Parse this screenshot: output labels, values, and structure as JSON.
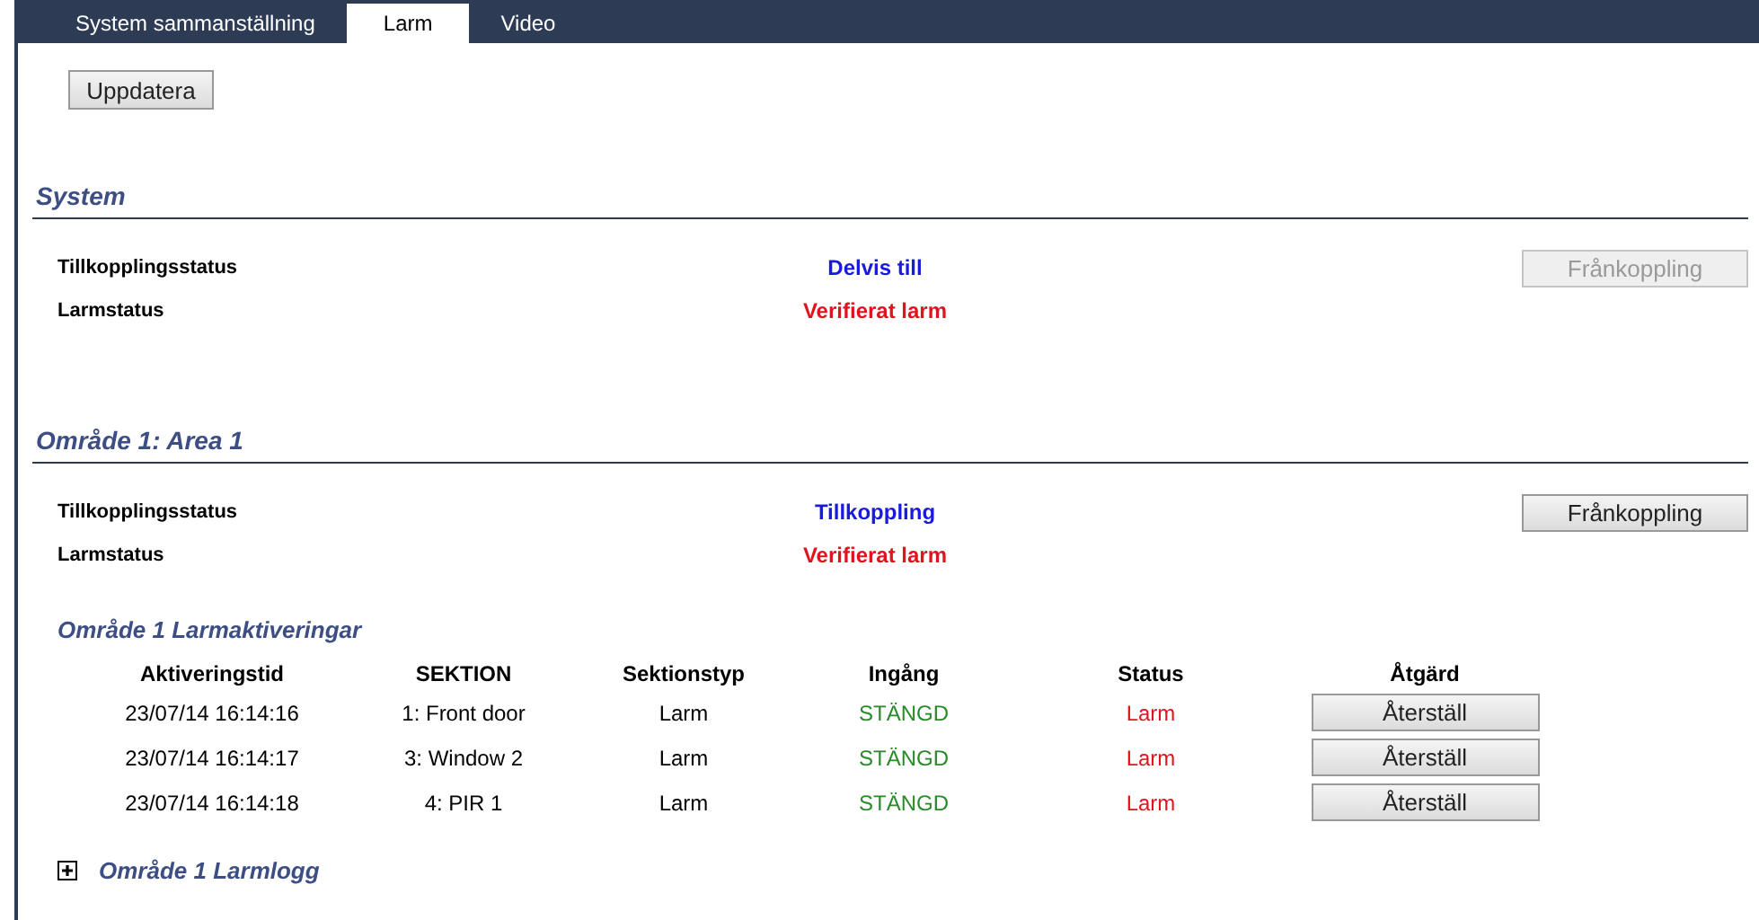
{
  "tabs": [
    {
      "label": "System sammanställning",
      "selected": false
    },
    {
      "label": "Larm",
      "selected": true
    },
    {
      "label": "Video",
      "selected": false
    }
  ],
  "refresh_button": "Uppdatera",
  "sections": [
    {
      "title": "System",
      "rows": [
        {
          "label": "Tillkopplingsstatus",
          "value": "Delvis till",
          "color": "#1a1adc",
          "button": {
            "label": "Frånkoppling",
            "disabled": true
          }
        },
        {
          "label": "Larmstatus",
          "value": "Verifierat larm",
          "color": "#e0141e"
        }
      ]
    },
    {
      "title": "Område 1: Area 1",
      "rows": [
        {
          "label": "Tillkopplingsstatus",
          "value": "Tillkoppling",
          "color": "#1a1adc",
          "button": {
            "label": "Frånkoppling",
            "disabled": false
          }
        },
        {
          "label": "Larmstatus",
          "value": "Verifierat larm",
          "color": "#e0141e"
        }
      ],
      "activations": {
        "title": "Område 1 Larmaktiveringar",
        "columns": [
          "Aktiveringstid",
          "SEKTION",
          "Sektionstyp",
          "Ingång",
          "Status",
          "Åtgärd"
        ],
        "rows": [
          {
            "time": "23/07/14 16:14:16",
            "section": "1: Front door",
            "type": "Larm",
            "input": "STÄNGD",
            "status": "Larm",
            "action": "Återställ"
          },
          {
            "time": "23/07/14 16:14:17",
            "section": "3: Window 2",
            "type": "Larm",
            "input": "STÄNGD",
            "status": "Larm",
            "action": "Återställ"
          },
          {
            "time": "23/07/14 16:14:18",
            "section": "4: PIR 1",
            "type": "Larm",
            "input": "STÄNGD",
            "status": "Larm",
            "action": "Återställ"
          }
        ]
      },
      "log": {
        "title": "Område 1 Larmlogg",
        "expanded": false
      }
    }
  ]
}
